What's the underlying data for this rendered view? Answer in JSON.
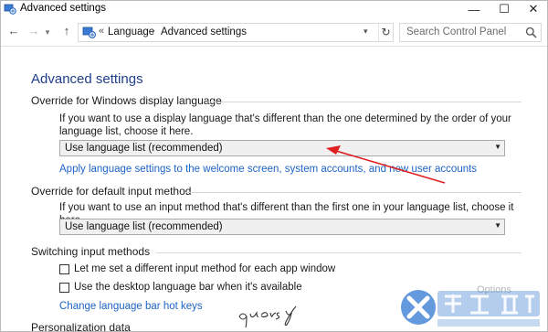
{
  "window": {
    "title": "Advanced settings",
    "controls": {
      "minimize": "—",
      "maximize": "☐",
      "close": "✕"
    }
  },
  "navigation": {
    "back_glyph": "←",
    "forward_glyph": "→",
    "dropdown_glyph": "▾",
    "up_glyph": "↑",
    "breadcrumb_prefix": "«",
    "breadcrumb": [
      "Language",
      "Advanced settings"
    ],
    "separator": "›",
    "refresh_glyph": "↻",
    "search_placeholder": "Search Control Panel"
  },
  "page": {
    "title": "Advanced settings",
    "display_language": {
      "heading": "Override for Windows display language",
      "description": "If you want to use a display language that's different than the one determined by the order of your language list, choose it here.",
      "selected": "Use language list (recommended)",
      "link": "Apply language settings to the welcome screen, system accounts, and new user accounts"
    },
    "input_method": {
      "heading": "Override for default input method",
      "description": "If you want to use an input method that's different than the first one in your language list, choose it here.",
      "selected": "Use language list (recommended)"
    },
    "switching": {
      "heading": "Switching input methods",
      "checkbox_per_app": "Let me set a different input method for each app window",
      "checkbox_language_bar": "Use the desktop language bar when it's available",
      "options_link": "Options",
      "hotkeys_link": "Change language bar hot keys"
    },
    "personalization": {
      "heading": "Personalization data"
    }
  },
  "annotation": {
    "signature": "quersy",
    "watermark_text": "系统城",
    "watermark_sub": "XITONGCHENG.CC"
  },
  "colors": {
    "title_blue": "#1f3f8a",
    "link_blue": "#1d64c8",
    "arrow_red": "#e02020",
    "watermark_blue": "#3d7fd6"
  }
}
